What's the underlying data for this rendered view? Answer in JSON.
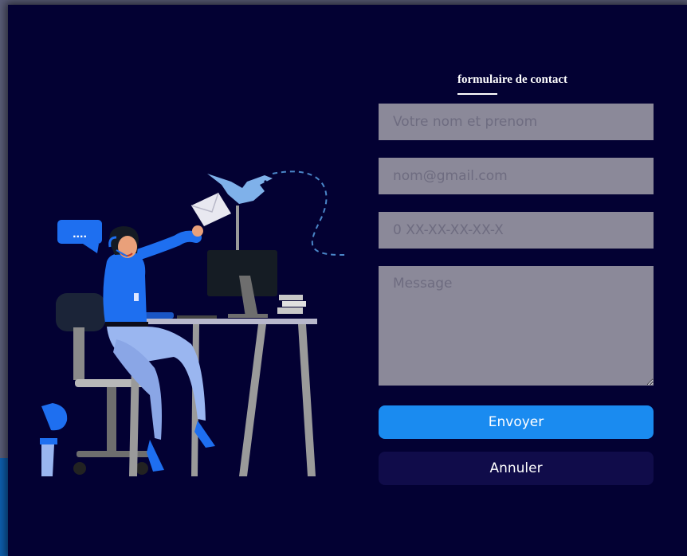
{
  "form": {
    "title": "formulaire de contact",
    "name_placeholder": "Votre nom et prenom",
    "email_placeholder": "nom@gmail.com",
    "phone_placeholder": "0 XX-XX-XX-XX-X",
    "message_placeholder": "Message",
    "submit_label": "Envoyer",
    "cancel_label": "Annuler"
  },
  "colors": {
    "card_background": "#030133",
    "field_background": "#8b8999",
    "submit_button": "#1a8bf0",
    "cancel_button": "#100c4a",
    "accent_blue": "#1e6ff0"
  },
  "illustration": {
    "speech_bubble_text": "....",
    "icons": [
      "speech-bubble-icon",
      "dove-icon",
      "envelope-icon"
    ]
  }
}
